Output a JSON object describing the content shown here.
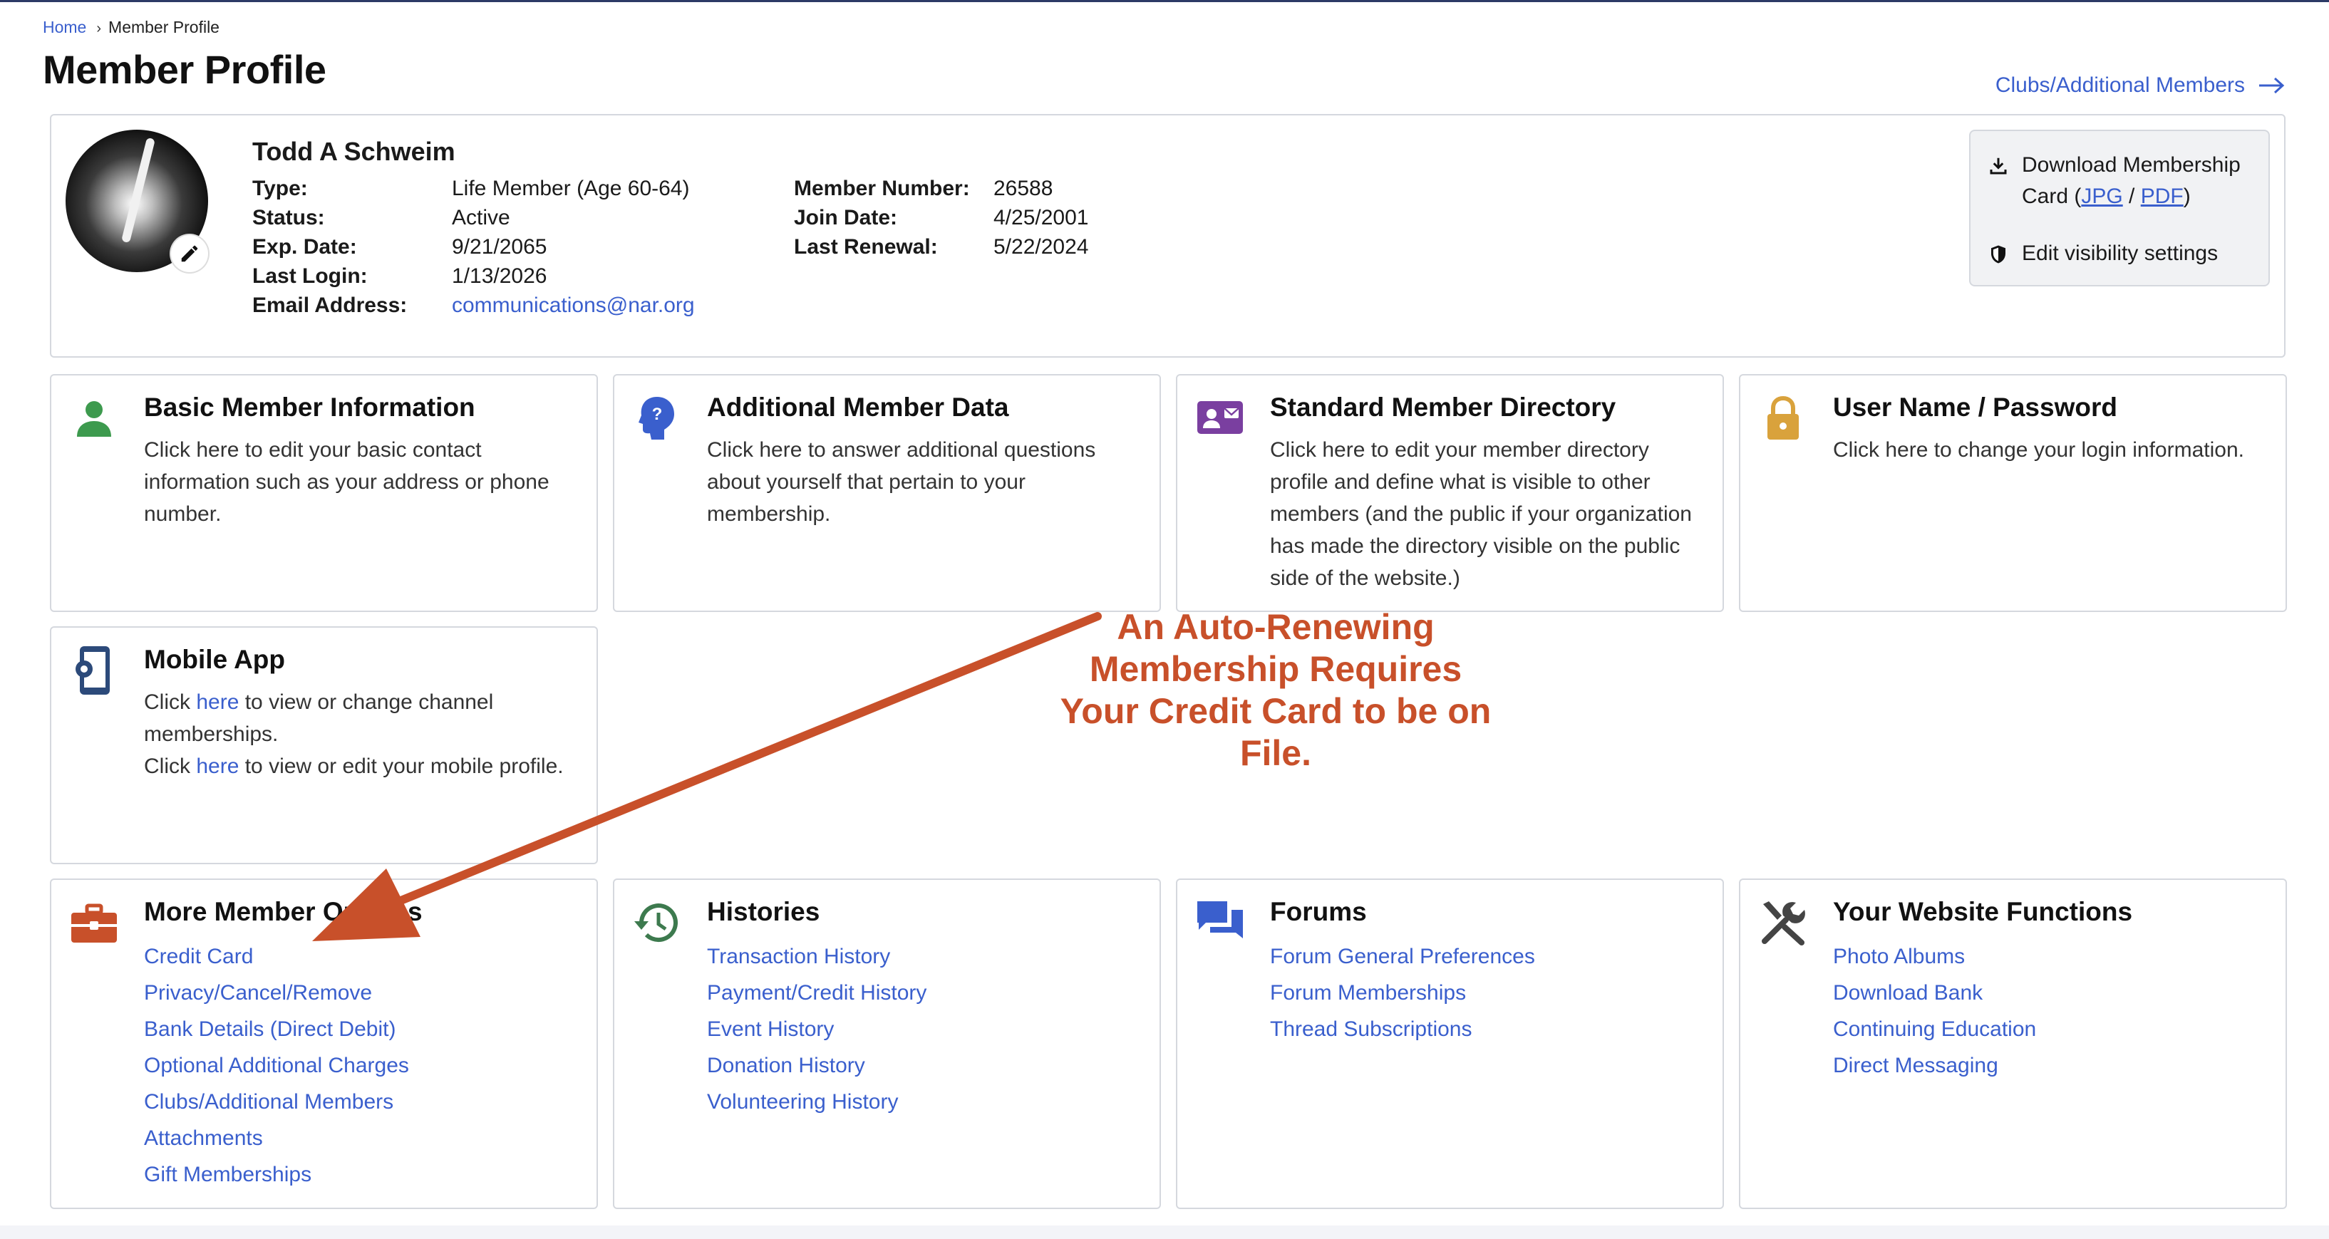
{
  "breadcrumb": {
    "home": "Home",
    "current": "Member Profile"
  },
  "page_title": "Member Profile",
  "top_link": "Clubs/Additional Members",
  "profile": {
    "name": "Todd A Schweim",
    "fields_left": [
      {
        "label": "Type:",
        "value": "Life Member (Age 60-64)"
      },
      {
        "label": "Status:",
        "value": "Active"
      },
      {
        "label": "Exp. Date:",
        "value": "9/21/2065"
      },
      {
        "label": "Last Login:",
        "value": "1/13/2026"
      },
      {
        "label": "Email Address:",
        "value": "communications@nar.org"
      }
    ],
    "fields_right": [
      {
        "label": "Member Number:",
        "value": "26588"
      },
      {
        "label": "Join Date:",
        "value": "4/25/2001"
      },
      {
        "label": "Last Renewal:",
        "value": "5/22/2024"
      }
    ],
    "download": {
      "line1": "Download Membership",
      "card_text": "Card (",
      "jpg": "JPG",
      "slash": " / ",
      "pdf": "PDF",
      "close": ")"
    },
    "visibility": "Edit visibility settings"
  },
  "cards": {
    "basic": {
      "title": "Basic Member Information",
      "desc": "Click here to edit your basic contact information such as your address or phone number.",
      "icon": "person-icon",
      "color": "#3d9a4e"
    },
    "additional": {
      "title": "Additional Member Data",
      "desc": "Click here to answer additional questions about yourself that pertain to your membership.",
      "icon": "question-head-icon",
      "color": "#3a5fcd"
    },
    "directory": {
      "title": "Standard Member Directory",
      "desc": "Click here to edit your member directory profile and define what is visible to other members (and the public if your organization has made the directory visible on the public side of the website.)",
      "icon": "contact-card-icon",
      "color": "#7a3fa0"
    },
    "password": {
      "title": "User Name / Password",
      "desc": "Click here to change your login information.",
      "icon": "lock-icon",
      "color": "#d9a23c"
    },
    "mobile": {
      "title": "Mobile App",
      "line1_pre": "Click ",
      "here": "here",
      "line1_post": " to view or change channel memberships.",
      "line2_pre": "Click ",
      "line2_post": " to view or edit your mobile profile.",
      "icon": "mobile-gear-icon",
      "color": "#2c4a7a"
    },
    "more": {
      "title": "More Member Options",
      "links": [
        "Credit Card",
        "Privacy/Cancel/Remove",
        "Bank Details (Direct Debit)",
        "Optional Additional Charges",
        "Clubs/Additional Members",
        "Attachments",
        "Gift Memberships"
      ],
      "icon": "briefcase-icon",
      "color": "#c8502a"
    },
    "histories": {
      "title": "Histories",
      "links": [
        "Transaction History",
        "Payment/Credit History",
        "Event History",
        "Donation History",
        "Volunteering History"
      ],
      "icon": "history-icon",
      "color": "#3d7a4e"
    },
    "forums": {
      "title": "Forums",
      "links": [
        "Forum General Preferences",
        "Forum Memberships",
        "Thread Subscriptions"
      ],
      "icon": "chat-bubbles-icon",
      "color": "#3a5fcd"
    },
    "website": {
      "title": "Your Website Functions",
      "links": [
        "Photo Albums",
        "Download Bank",
        "Continuing Education",
        "Direct Messaging"
      ],
      "icon": "tools-icon",
      "color": "#444444"
    }
  },
  "annotation": "An Auto-Renewing Membership Requires Your Credit Card to be on File.",
  "annotation_color": "#c8502a"
}
